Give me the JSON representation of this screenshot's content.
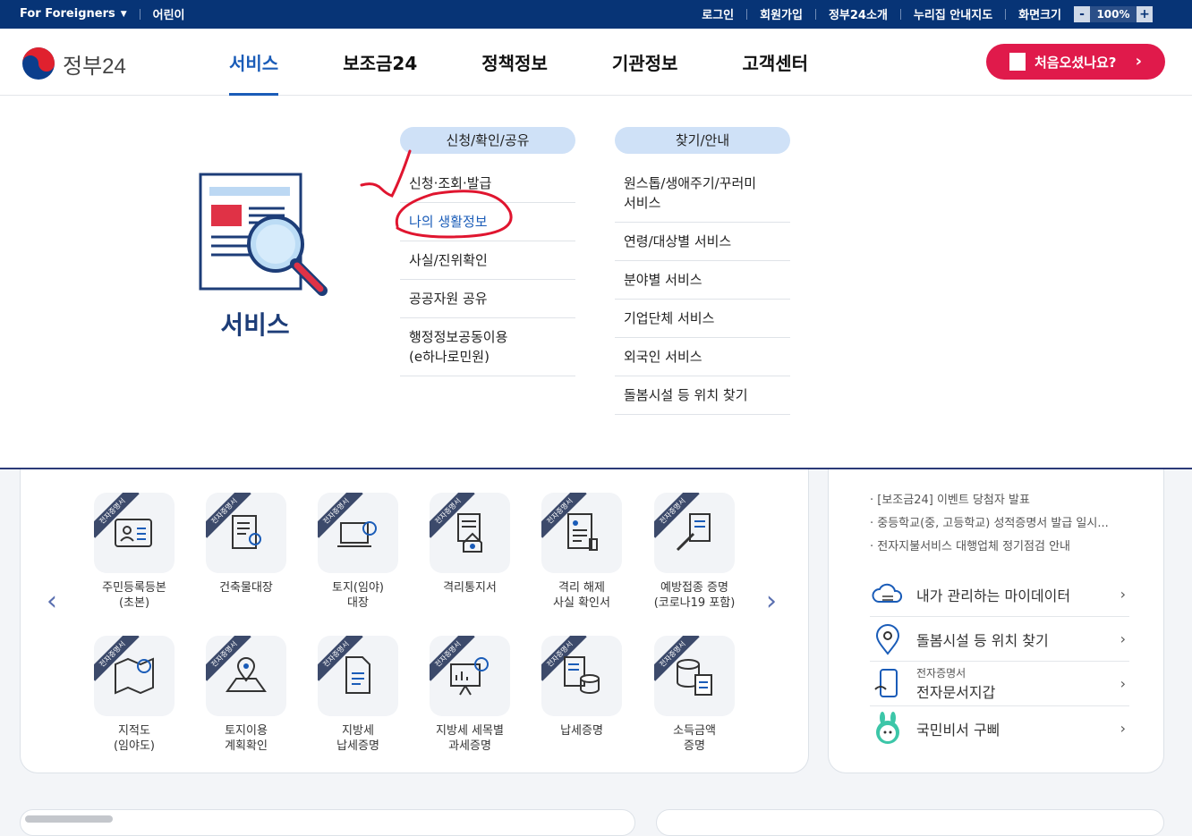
{
  "topbar": {
    "foreigners": "For Foreigners",
    "kids": "어린이",
    "links": [
      "로그인",
      "회원가입",
      "정부24소개",
      "누리집 안내지도",
      "화면크기"
    ],
    "zoom_minus": "-",
    "zoom_value": "100%",
    "zoom_plus": "+"
  },
  "header": {
    "logo_text": "정부24",
    "nav": [
      "서비스",
      "보조금24",
      "정책정보",
      "기관정보",
      "고객센터"
    ],
    "first_visit": "처음오셨나요?",
    "first_visit_chevron": "›"
  },
  "mega": {
    "title": "서비스",
    "col1": {
      "heading": "신청/확인/공유",
      "items": [
        "신청·조회·발급",
        "나의 생활정보",
        "사실/진위확인",
        "공공자원 공유",
        "행정정보공동이용\n(e하나로민원)"
      ]
    },
    "col2": {
      "heading": "찾기/안내",
      "items": [
        "원스톱/생애주기/꾸러미\n서비스",
        "연령/대상별 서비스",
        "분야별 서비스",
        "기업단체 서비스",
        "외국인 서비스",
        "돌봄시설 등 위치 찾기"
      ]
    },
    "annotation_color": "#e0152f"
  },
  "services": {
    "ribbon": "전자증명서",
    "row1": [
      "주민등록등본\n(초본)",
      "건축물대장",
      "토지(임야)\n대장",
      "격리통지서",
      "격리 해제\n사실 확인서",
      "예방접종 증명\n(코로나19 포함)"
    ],
    "row2": [
      "지적도\n(임야도)",
      "토지이용\n계획확인",
      "지방세\n납세증명",
      "지방세 세목별\n과세증명",
      "납세증명",
      "소득금액\n증명"
    ],
    "prev": "‹",
    "next": "›"
  },
  "side": {
    "notices": [
      "[보조금24] 이벤트 당첨자 발표",
      "중등학교(중, 고등학교) 성적증명서 발급 일시...",
      "전자지불서비스 대행업체 정기점검 안내"
    ],
    "quick": [
      {
        "title": "내가 관리하는 마이데이터",
        "sub": "",
        "icon": "cloud-icon"
      },
      {
        "title": "돌봄시설 등 위치 찾기",
        "sub": "",
        "icon": "location-pin-icon"
      },
      {
        "title": "전자문서지갑",
        "sub": "전자증명서",
        "icon": "phone-wallet-icon"
      },
      {
        "title": "국민비서 구삐",
        "sub": "",
        "icon": "rabbit-mascot-icon"
      }
    ],
    "chevron": "›"
  }
}
